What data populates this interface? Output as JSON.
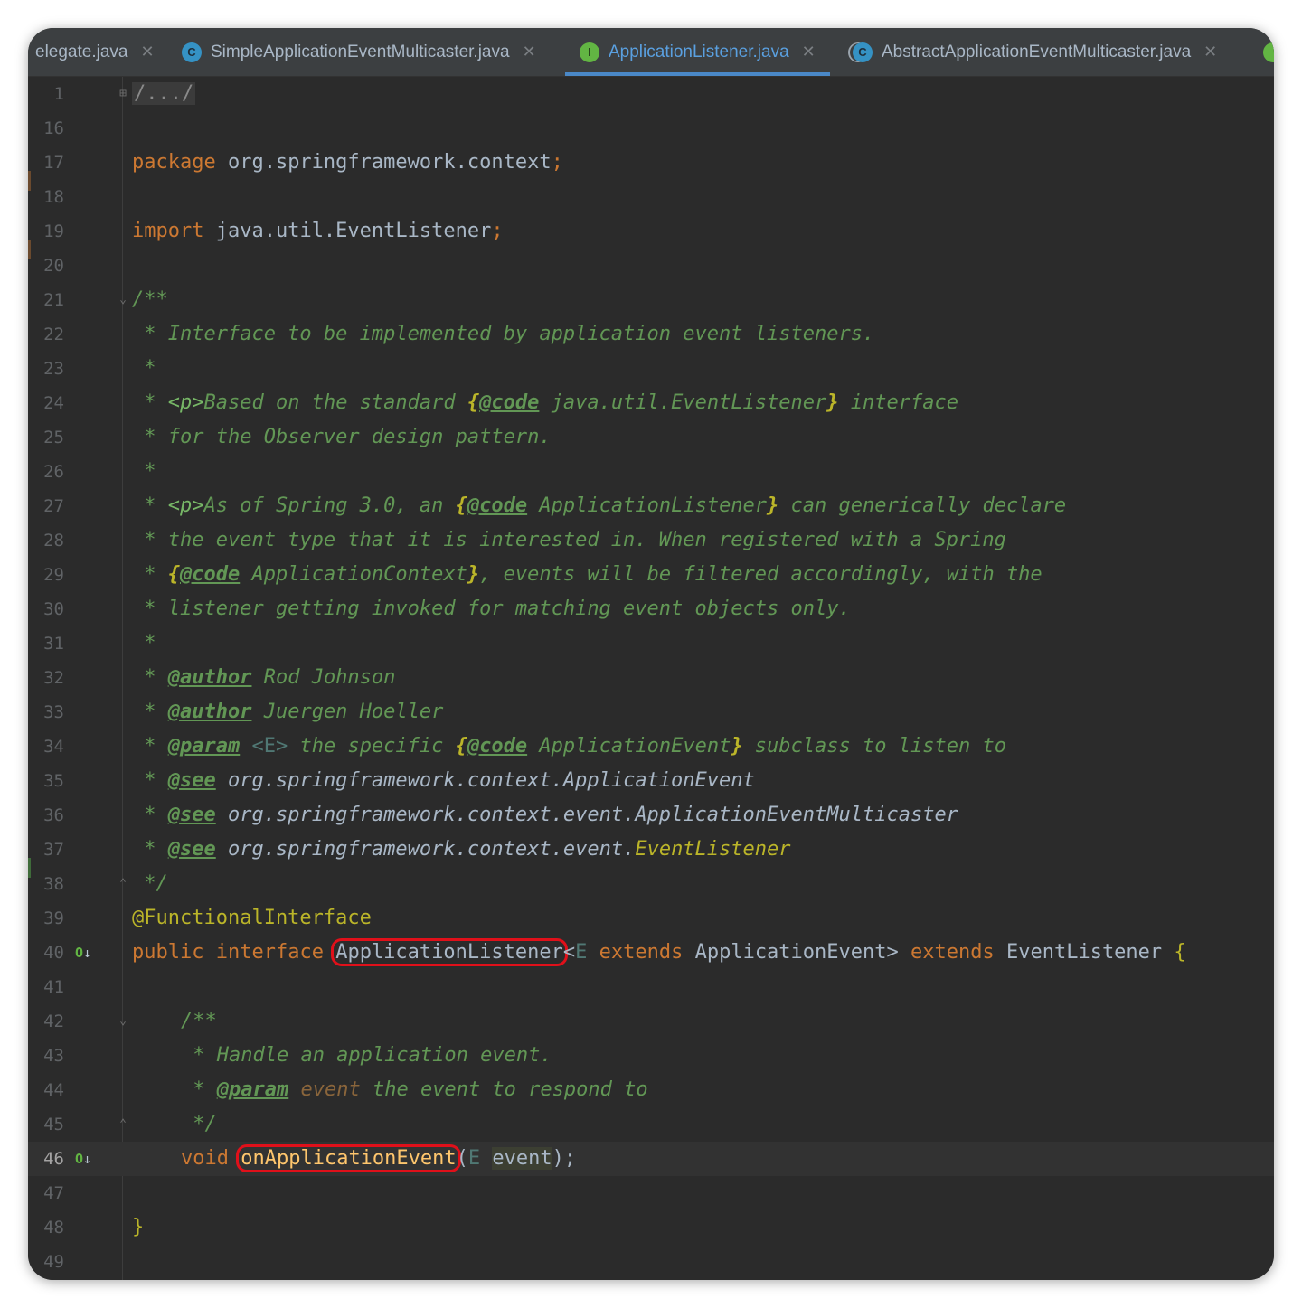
{
  "tabs": [
    {
      "label": "elegate.java",
      "icon": "",
      "active": false
    },
    {
      "label": "SimpleApplicationEventMulticaster.java",
      "icon": "C",
      "active": false
    },
    {
      "label": "ApplicationListener.java",
      "icon": "I",
      "active": true
    },
    {
      "label": "AbstractApplicationEventMulticaster.java",
      "icon": "C",
      "active": false
    }
  ],
  "line_numbers": [
    "1",
    "16",
    "17",
    "18",
    "19",
    "20",
    "21",
    "22",
    "23",
    "24",
    "25",
    "26",
    "27",
    "28",
    "29",
    "30",
    "31",
    "32",
    "33",
    "34",
    "35",
    "36",
    "37",
    "38",
    "39",
    "40",
    "41",
    "42",
    "43",
    "44",
    "45",
    "46",
    "47",
    "48",
    "49"
  ],
  "code": {
    "fold_header": "/.../",
    "package_kw": "package",
    "package_name": " org.springframework.context",
    "semicolon": ";",
    "import_kw": "import",
    "import_name": " java.util.EventListener",
    "doc_open": "/**",
    "l22": " * Interface to be implemented by application event listeners.",
    "star": " *",
    "l24_a": " * ",
    "p_tag": "<p>",
    "l24_b": "Based on the standard ",
    "brace_open": "{",
    "code_tag": "@code",
    "l24_c": " java.util.EventListener",
    "brace_close": "}",
    "l24_d": " interface",
    "l25": " * for the Observer design pattern.",
    "l27_b": "As of Spring 3.0, an ",
    "l27_c": " ApplicationListener",
    "l27_d": " can generically declare",
    "l28": " * the event type that it is interested in. When registered with a Spring",
    "l29_c": " ApplicationContext",
    "l29_d": ", events will be filtered accordingly, with the",
    "l30": " * listener getting invoked for matching event objects only.",
    "author_tag": "@author",
    "author1": " Rod Johnson",
    "author2": " Juergen Hoeller",
    "param_tag": "@param",
    "type_param": " <E>",
    "l34_b": " the specific ",
    "l34_c": " ApplicationEvent",
    "l34_d": " subclass to listen to",
    "see_tag": "@see",
    "see1": " org.springframework.context.ApplicationEvent",
    "see2": " org.springframework.context.event.ApplicationEventMulticaster",
    "see3_a": " org.springframework.context.event.",
    "see3_b": "EventListener",
    "doc_close": " */",
    "annotation": "@FunctionalInterface",
    "public_kw": "public",
    "interface_kw": "interface",
    "class_name": "ApplicationListener",
    "lt": "<",
    "type_E": "E",
    "extends_kw": "extends",
    "app_event_gt": " ApplicationEvent>",
    "event_listener": " EventListener ",
    "open_brace": "{",
    "doc2_open": "/**",
    "l43": " * Handle an application event.",
    "l44_a": " * ",
    "param_name": " event",
    "l44_c": " the event to respond to",
    "doc2_close": " */",
    "void_kw": "void",
    "method_name": "onApplicationEvent",
    "paren_open": "(",
    "arg_name": "event",
    "paren_close": ");",
    "close_brace": "}"
  },
  "colors": {
    "editor_bg": "#2b2b2b",
    "keyword": "#cc7832",
    "doc_comment": "#629755",
    "annotation": "#bbb529",
    "method": "#ffc66d",
    "highlight_box": "#e0101a"
  }
}
